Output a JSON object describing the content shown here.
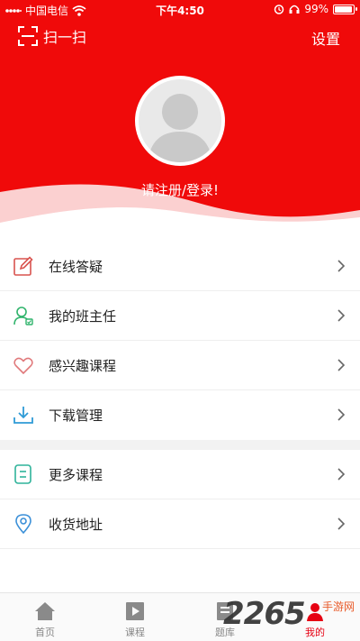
{
  "status_bar": {
    "carrier": "中国电信",
    "time": "下午4:50",
    "battery": "99%",
    "battery_level": 0.99
  },
  "header": {
    "scan_label": "扫一扫",
    "settings_label": "设置",
    "login_prompt": "请注册/登录!"
  },
  "menu": [
    {
      "label": "在线答疑",
      "icon": "edit-icon"
    },
    {
      "label": "我的班主任",
      "icon": "teacher-icon"
    },
    {
      "label": "感兴趣课程",
      "icon": "heart-icon"
    },
    {
      "label": "下载管理",
      "icon": "download-icon"
    }
  ],
  "menu2": [
    {
      "label": "更多课程",
      "icon": "document-icon"
    },
    {
      "label": "收货地址",
      "icon": "location-pin-icon"
    }
  ],
  "tabs": [
    {
      "label": "首页",
      "icon": "home-icon"
    },
    {
      "label": "课程",
      "icon": "play-icon"
    },
    {
      "label": "题库",
      "icon": "question-bank-icon"
    },
    {
      "label": "我的",
      "icon": "profile-icon"
    }
  ],
  "watermark": {
    "number": "2265",
    "text": "手游网"
  },
  "colors": {
    "primary_red": "#f00a0a",
    "active_tab": "#e60012"
  }
}
